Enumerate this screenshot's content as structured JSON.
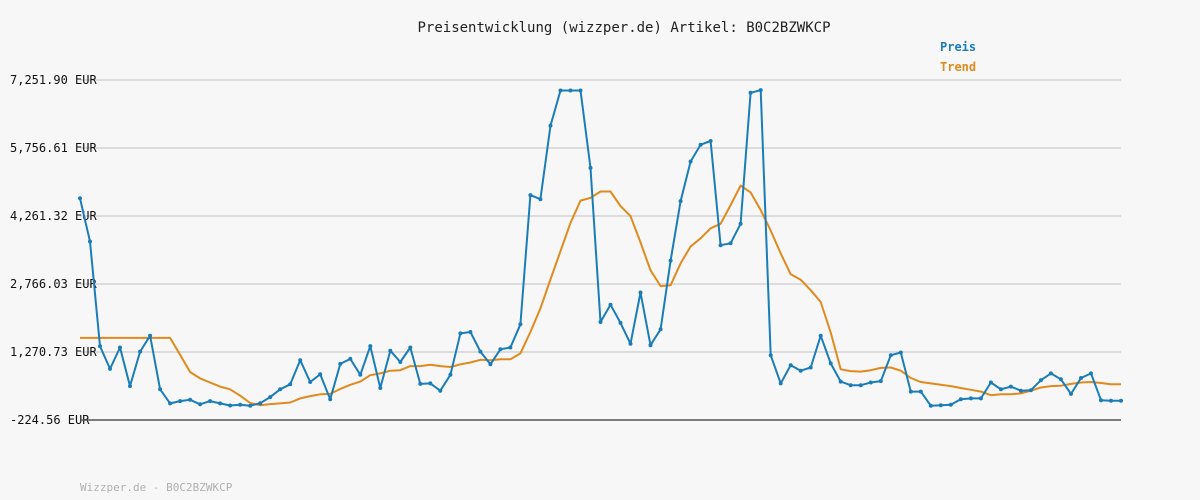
{
  "chart_data": {
    "type": "line",
    "title": "Preisentwicklung (wizzper.de) Artikel: B0C2BZWKCP",
    "footer": "Wizzper.de - B0C2BZWKCP",
    "y_tick_labels": [
      "7,251.90 EUR",
      "5,756.61 EUR",
      "4,261.32 EUR",
      "2,766.03 EUR",
      "1,270.73 EUR",
      "-224.56 EUR"
    ],
    "y_ticks": [
      7251.9,
      5756.61,
      4261.32,
      2766.03,
      1270.73,
      -224.56
    ],
    "ylim": [
      -224.56,
      7251.9
    ],
    "grid": true,
    "legend_position": "top-right",
    "series": [
      {
        "name": "Preis",
        "color": "#1a7db8",
        "values": [
          4650,
          3700,
          1400,
          900,
          1370,
          520,
          1280,
          1630,
          450,
          140,
          190,
          220,
          120,
          190,
          140,
          95,
          110,
          90,
          145,
          280,
          450,
          560,
          1090,
          610,
          780,
          230,
          1010,
          1120,
          770,
          1400,
          480,
          1300,
          1050,
          1370,
          570,
          580,
          420,
          770,
          1680,
          1710,
          1280,
          1000,
          1330,
          1370,
          1880,
          4720,
          4630,
          6250,
          7020,
          7020,
          7020,
          5320,
          1930,
          2310,
          1910,
          1450,
          2580,
          1420,
          1770,
          3280,
          4590,
          5460,
          5830,
          5910,
          3620,
          3660,
          4090,
          6970,
          7030,
          1200,
          580,
          980,
          860,
          930,
          1630,
          1020,
          620,
          540,
          540,
          600,
          630,
          1200,
          1260,
          400,
          400,
          90,
          100,
          110,
          230,
          250,
          250,
          600,
          450,
          510,
          420,
          430,
          650,
          800,
          670,
          350,
          700,
          800,
          210,
          200,
          200
        ]
      },
      {
        "name": "Trend",
        "color": "#e08a1e",
        "values": [
          1580,
          1580,
          1580,
          1580,
          1580,
          1580,
          1580,
          1580,
          1580,
          1580,
          1210,
          830,
          690,
          600,
          510,
          450,
          310,
          150,
          100,
          125,
          140,
          160,
          250,
          300,
          340,
          350,
          460,
          550,
          620,
          760,
          800,
          860,
          870,
          960,
          960,
          990,
          960,
          940,
          1000,
          1040,
          1100,
          1090,
          1110,
          1110,
          1240,
          1710,
          2230,
          2870,
          3490,
          4110,
          4600,
          4660,
          4800,
          4800,
          4480,
          4260,
          3680,
          3070,
          2720,
          2740,
          3220,
          3590,
          3770,
          3990,
          4090,
          4500,
          4930,
          4780,
          4390,
          3940,
          3440,
          2980,
          2860,
          2630,
          2370,
          1700,
          890,
          850,
          840,
          870,
          920,
          930,
          860,
          700,
          610,
          580,
          550,
          520,
          480,
          440,
          400,
          320,
          340,
          340,
          360,
          420,
          490,
          520,
          530,
          570,
          600,
          610,
          590,
          560,
          560
        ]
      }
    ]
  }
}
